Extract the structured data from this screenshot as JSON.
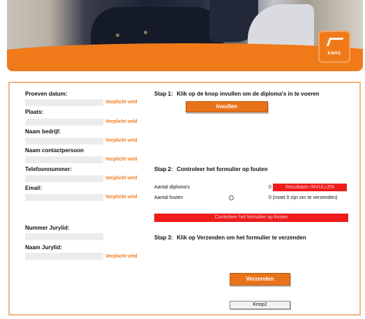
{
  "header": {
    "logo_text": "KNHS",
    "colors": {
      "brand_orange": "#f07a1a",
      "error_red": "#ef1b1b"
    }
  },
  "form": {
    "required_label": "Verplicht veld",
    "fields": [
      {
        "label": "Proeven datum:",
        "required": true
      },
      {
        "label": "Plaats:",
        "required": true
      },
      {
        "label": "Naam bedrijf:",
        "required": true
      },
      {
        "label": "Naam contactpersoon",
        "required": true
      },
      {
        "label": "Telefoonnummer:",
        "required": true
      },
      {
        "label": "Email:",
        "required": true
      },
      {
        "label": "Nummer Jurylid:",
        "required": false
      },
      {
        "label": "Naam Jurylid:",
        "required": true
      }
    ]
  },
  "steps": {
    "step1": {
      "num": "Stap 1:",
      "text": "Klik op de knop invullen om de diploma's in te voeren",
      "button": "Invullen"
    },
    "step2": {
      "num": "Stap 2:",
      "text": "Controleer het formulier op fouten",
      "diplomas_label": "Aantal diploma's",
      "diplomas_value": "0",
      "diplomas_badge": "Resultaten INVULLEN",
      "errors_label": "Aantal fouten",
      "errors_value": "0 (moet 0 zijn om te verzenden)",
      "check_button": "Controleer het formulier op fouten"
    },
    "step3": {
      "num": "Stap 3:",
      "text": "Klik op Verzenden om het formulier te verzenden",
      "button": "Verzenden",
      "secondary_button": "Knop2"
    }
  }
}
